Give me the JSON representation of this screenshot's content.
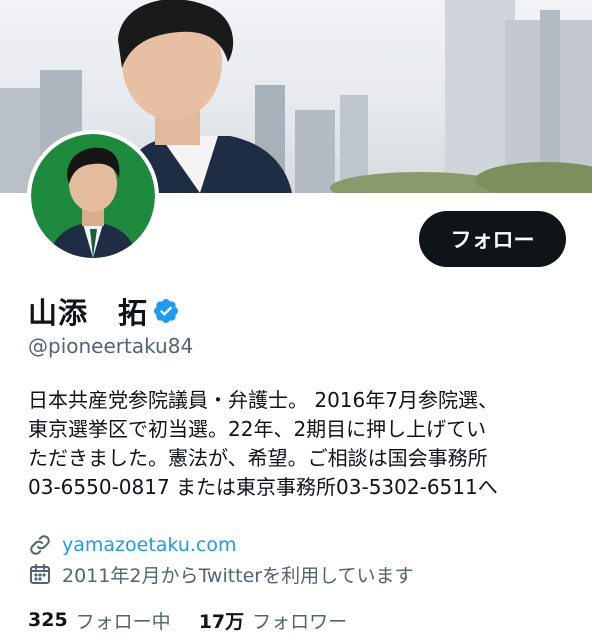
{
  "colors": {
    "primary_text": "#0f1419",
    "secondary_text": "#536471",
    "link": "#1d9bf0",
    "verified": "#1d9bf0",
    "follow_button_bg": "#0f1419",
    "avatar_bg": "#1e8a3e"
  },
  "profile": {
    "display_name": "山添　拓",
    "handle": "@pioneertaku84",
    "verified_icon": "verified-badge-icon",
    "follow_label": "フォロー",
    "bio_lines": [
      "日本共産党参院議員・弁護士。 2016年7月参院選、",
      "東京選挙区で初当選。22年、2期目に押し上げてい",
      "ただきました。憲法が、希望。ご相談は国会事務所",
      "03-6550-0817 または東京事務所03-5302-6511へ"
    ],
    "website": "yamazoetaku.com",
    "website_icon": "link-icon",
    "joined": "2011年2月からTwitterを利用しています",
    "joined_icon": "calendar-icon"
  },
  "stats": {
    "following_count": "325",
    "following_label": "フォロー中",
    "followers_count": "17万",
    "followers_label": "フォロワー"
  }
}
